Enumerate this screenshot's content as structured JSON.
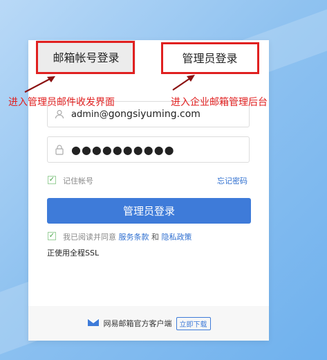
{
  "tabs": {
    "mailbox_account_login": "邮箱帐号登录",
    "admin_login": "管理员登录"
  },
  "annotations": {
    "left": "进入管理员邮件收发界面",
    "right": "进入企业邮箱管理后台"
  },
  "form": {
    "username_prefix": "admin@",
    "username_domain": "gongsiyuming.com",
    "password_mask": "●●●●●●●●●●",
    "remember_label": "记住帐号",
    "forgot_password": "忘记密码",
    "submit_label": "管理员登录",
    "agree_prefix": "我已阅读并同意",
    "terms_link": "服务条款",
    "and_text": "和",
    "privacy_link": "隐私政策",
    "ssl_text": "正使用全程SSL"
  },
  "footer": {
    "client_label": "网易邮箱官方客户端",
    "download_label": "立即下载"
  },
  "colors": {
    "primary": "#3e7bd9",
    "annotation_red": "#e02020",
    "check_green": "#47a447"
  }
}
